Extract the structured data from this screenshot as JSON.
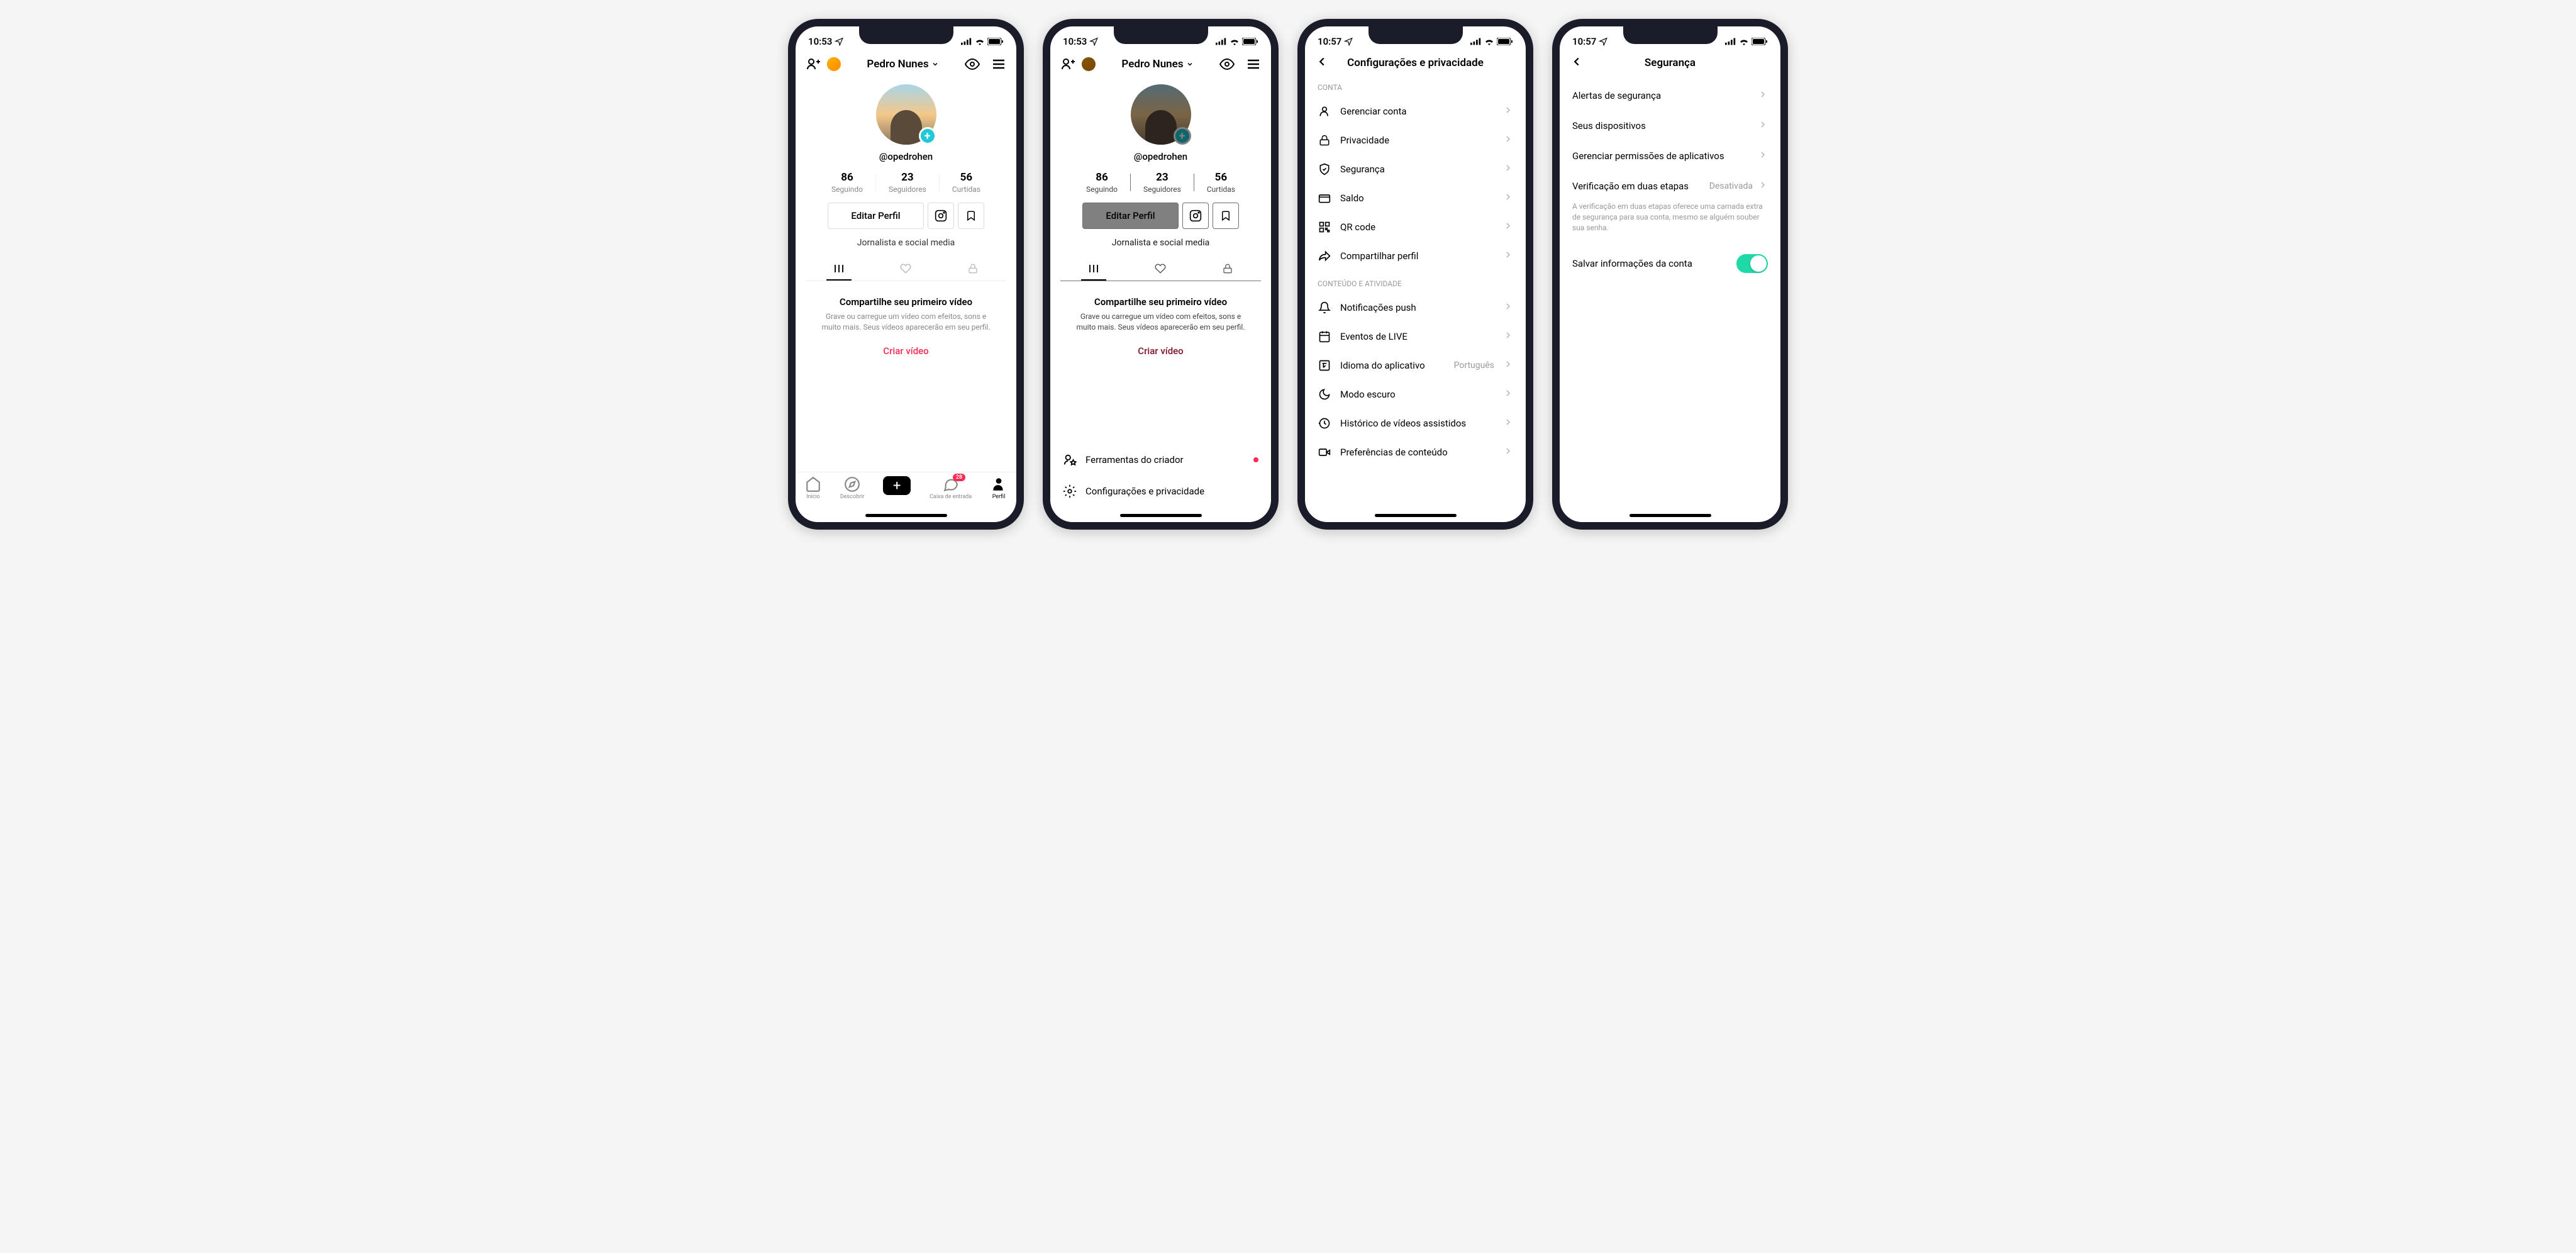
{
  "status": {
    "time_1": "10:53",
    "time_2": "10:57"
  },
  "profile": {
    "name": "Pedro Nunes",
    "handle": "@opedrohen",
    "stats": {
      "following_num": "86",
      "following_label": "Seguindo",
      "followers_num": "23",
      "followers_label": "Seguidores",
      "likes_num": "56",
      "likes_label": "Curtidas"
    },
    "edit_label": "Editar Perfil",
    "bio": "Jornalista e social media",
    "empty_title": "Compartilhe seu primeiro vídeo",
    "empty_desc": "Grave ou carregue um vídeo com efeitos, sons e muito mais. Seus vídeos aparecerão em seu perfil.",
    "create_label": "Criar vídeo"
  },
  "nav": {
    "home": "Início",
    "discover": "Descobrir",
    "inbox": "Caixa de entrada",
    "inbox_badge": "28",
    "profile": "Perfil"
  },
  "sheet": {
    "creator_tools": "Ferramentas do criador",
    "settings_privacy": "Configurações e privacidade"
  },
  "settings": {
    "title": "Configurações e privacidade",
    "section_account": "CONTA",
    "manage_account": "Gerenciar conta",
    "privacy": "Privacidade",
    "security": "Segurança",
    "balance": "Saldo",
    "qr": "QR code",
    "share_profile": "Compartilhar perfil",
    "section_content": "CONTEÚDO E ATIVIDADE",
    "push": "Notificações push",
    "live_events": "Eventos de LIVE",
    "language": "Idioma do aplicativo",
    "language_value": "Português",
    "dark_mode": "Modo escuro",
    "watch_history": "Histórico de vídeos assistidos",
    "content_prefs": "Preferências de conteúdo"
  },
  "security_page": {
    "title": "Segurança",
    "alerts": "Alertas de segurança",
    "devices": "Seus dispositivos",
    "app_permissions": "Gerenciar permissões de aplicativos",
    "two_step": "Verificação em duas etapas",
    "two_step_value": "Desativada",
    "two_step_desc": "A verificação em duas etapas oferece uma camada extra de segurança para sua conta, mesmo se alguém souber sua senha.",
    "save_info": "Salvar informações da conta"
  }
}
